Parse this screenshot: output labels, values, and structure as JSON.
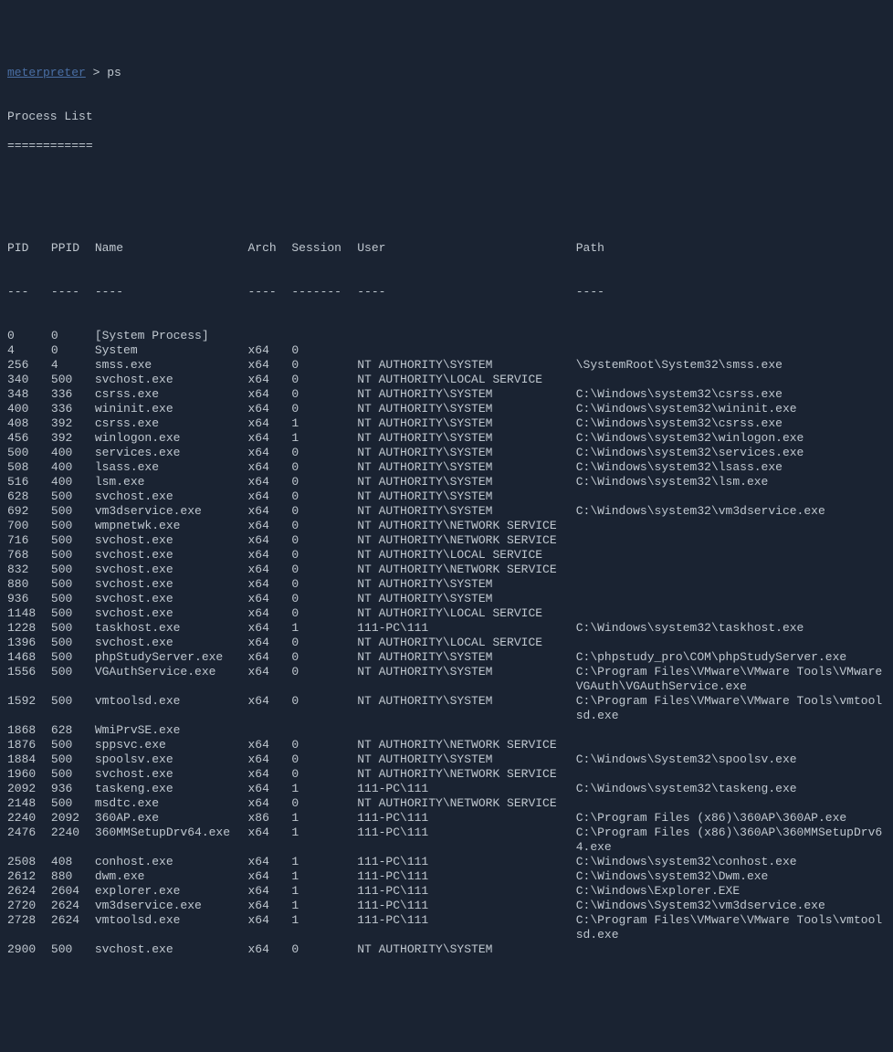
{
  "prompt": {
    "label": "meterpreter",
    "separator": " > ",
    "command": "ps"
  },
  "title": "Process List",
  "title_underline": "============",
  "headers": {
    "pid": "PID",
    "ppid": "PPID",
    "name": "Name",
    "arch": "Arch",
    "session": "Session",
    "user": "User",
    "path": "Path"
  },
  "header_underlines": {
    "pid": "---",
    "ppid": "----",
    "name": "----",
    "arch": "----",
    "session": "-------",
    "user": "----",
    "path": "----"
  },
  "processes": [
    {
      "pid": "0",
      "ppid": "0",
      "name": "[System Process]",
      "arch": "",
      "session": "",
      "user": "",
      "path": ""
    },
    {
      "pid": "4",
      "ppid": "0",
      "name": "System",
      "arch": "x64",
      "session": "0",
      "user": "",
      "path": ""
    },
    {
      "pid": "256",
      "ppid": "4",
      "name": "smss.exe",
      "arch": "x64",
      "session": "0",
      "user": "NT AUTHORITY\\SYSTEM",
      "path": "\\SystemRoot\\System32\\smss.exe"
    },
    {
      "pid": "340",
      "ppid": "500",
      "name": "svchost.exe",
      "arch": "x64",
      "session": "0",
      "user": "NT AUTHORITY\\LOCAL SERVICE",
      "path": ""
    },
    {
      "pid": "348",
      "ppid": "336",
      "name": "csrss.exe",
      "arch": "x64",
      "session": "0",
      "user": "NT AUTHORITY\\SYSTEM",
      "path": "C:\\Windows\\system32\\csrss.exe"
    },
    {
      "pid": "400",
      "ppid": "336",
      "name": "wininit.exe",
      "arch": "x64",
      "session": "0",
      "user": "NT AUTHORITY\\SYSTEM",
      "path": "C:\\Windows\\system32\\wininit.exe"
    },
    {
      "pid": "408",
      "ppid": "392",
      "name": "csrss.exe",
      "arch": "x64",
      "session": "1",
      "user": "NT AUTHORITY\\SYSTEM",
      "path": "C:\\Windows\\system32\\csrss.exe"
    },
    {
      "pid": "456",
      "ppid": "392",
      "name": "winlogon.exe",
      "arch": "x64",
      "session": "1",
      "user": "NT AUTHORITY\\SYSTEM",
      "path": "C:\\Windows\\system32\\winlogon.exe"
    },
    {
      "pid": "500",
      "ppid": "400",
      "name": "services.exe",
      "arch": "x64",
      "session": "0",
      "user": "NT AUTHORITY\\SYSTEM",
      "path": "C:\\Windows\\system32\\services.exe"
    },
    {
      "pid": "508",
      "ppid": "400",
      "name": "lsass.exe",
      "arch": "x64",
      "session": "0",
      "user": "NT AUTHORITY\\SYSTEM",
      "path": "C:\\Windows\\system32\\lsass.exe"
    },
    {
      "pid": "516",
      "ppid": "400",
      "name": "lsm.exe",
      "arch": "x64",
      "session": "0",
      "user": "NT AUTHORITY\\SYSTEM",
      "path": "C:\\Windows\\system32\\lsm.exe"
    },
    {
      "pid": "628",
      "ppid": "500",
      "name": "svchost.exe",
      "arch": "x64",
      "session": "0",
      "user": "NT AUTHORITY\\SYSTEM",
      "path": ""
    },
    {
      "pid": "692",
      "ppid": "500",
      "name": "vm3dservice.exe",
      "arch": "x64",
      "session": "0",
      "user": "NT AUTHORITY\\SYSTEM",
      "path": "C:\\Windows\\system32\\vm3dservice.exe"
    },
    {
      "pid": "700",
      "ppid": "500",
      "name": "wmpnetwk.exe",
      "arch": "x64",
      "session": "0",
      "user": "NT AUTHORITY\\NETWORK SERVICE",
      "path": ""
    },
    {
      "pid": "716",
      "ppid": "500",
      "name": "svchost.exe",
      "arch": "x64",
      "session": "0",
      "user": "NT AUTHORITY\\NETWORK SERVICE",
      "path": ""
    },
    {
      "pid": "768",
      "ppid": "500",
      "name": "svchost.exe",
      "arch": "x64",
      "session": "0",
      "user": "NT AUTHORITY\\LOCAL SERVICE",
      "path": ""
    },
    {
      "pid": "832",
      "ppid": "500",
      "name": "svchost.exe",
      "arch": "x64",
      "session": "0",
      "user": "NT AUTHORITY\\NETWORK SERVICE",
      "path": ""
    },
    {
      "pid": "880",
      "ppid": "500",
      "name": "svchost.exe",
      "arch": "x64",
      "session": "0",
      "user": "NT AUTHORITY\\SYSTEM",
      "path": ""
    },
    {
      "pid": "936",
      "ppid": "500",
      "name": "svchost.exe",
      "arch": "x64",
      "session": "0",
      "user": "NT AUTHORITY\\SYSTEM",
      "path": ""
    },
    {
      "pid": "1148",
      "ppid": "500",
      "name": "svchost.exe",
      "arch": "x64",
      "session": "0",
      "user": "NT AUTHORITY\\LOCAL SERVICE",
      "path": ""
    },
    {
      "pid": "1228",
      "ppid": "500",
      "name": "taskhost.exe",
      "arch": "x64",
      "session": "1",
      "user": "111-PC\\111",
      "path": "C:\\Windows\\system32\\taskhost.exe"
    },
    {
      "pid": "1396",
      "ppid": "500",
      "name": "svchost.exe",
      "arch": "x64",
      "session": "0",
      "user": "NT AUTHORITY\\LOCAL SERVICE",
      "path": ""
    },
    {
      "pid": "1468",
      "ppid": "500",
      "name": "phpStudyServer.exe",
      "arch": "x64",
      "session": "0",
      "user": "NT AUTHORITY\\SYSTEM",
      "path": "C:\\phpstudy_pro\\COM\\phpStudyServer.exe"
    },
    {
      "pid": "1556",
      "ppid": "500",
      "name": "VGAuthService.exe",
      "arch": "x64",
      "session": "0",
      "user": "NT AUTHORITY\\SYSTEM",
      "path": "C:\\Program Files\\VMware\\VMware Tools\\VMware VGAuth\\VGAuthService.exe"
    },
    {
      "pid": "1592",
      "ppid": "500",
      "name": "vmtoolsd.exe",
      "arch": "x64",
      "session": "0",
      "user": "NT AUTHORITY\\SYSTEM",
      "path": "C:\\Program Files\\VMware\\VMware Tools\\vmtoolsd.exe"
    },
    {
      "pid": "1868",
      "ppid": "628",
      "name": "WmiPrvSE.exe",
      "arch": "",
      "session": "",
      "user": "",
      "path": ""
    },
    {
      "pid": "1876",
      "ppid": "500",
      "name": "sppsvc.exe",
      "arch": "x64",
      "session": "0",
      "user": "NT AUTHORITY\\NETWORK SERVICE",
      "path": ""
    },
    {
      "pid": "1884",
      "ppid": "500",
      "name": "spoolsv.exe",
      "arch": "x64",
      "session": "0",
      "user": "NT AUTHORITY\\SYSTEM",
      "path": "C:\\Windows\\System32\\spoolsv.exe"
    },
    {
      "pid": "1960",
      "ppid": "500",
      "name": "svchost.exe",
      "arch": "x64",
      "session": "0",
      "user": "NT AUTHORITY\\NETWORK SERVICE",
      "path": ""
    },
    {
      "pid": "2092",
      "ppid": "936",
      "name": "taskeng.exe",
      "arch": "x64",
      "session": "1",
      "user": "111-PC\\111",
      "path": "C:\\Windows\\system32\\taskeng.exe"
    },
    {
      "pid": "2148",
      "ppid": "500",
      "name": "msdtc.exe",
      "arch": "x64",
      "session": "0",
      "user": "NT AUTHORITY\\NETWORK SERVICE",
      "path": ""
    },
    {
      "pid": "2240",
      "ppid": "2092",
      "name": "360AP.exe",
      "arch": "x86",
      "session": "1",
      "user": "111-PC\\111",
      "path": "C:\\Program Files (x86)\\360AP\\360AP.exe"
    },
    {
      "pid": "2476",
      "ppid": "2240",
      "name": "360MMSetupDrv64.exe",
      "arch": "x64",
      "session": "1",
      "user": "111-PC\\111",
      "path": "C:\\Program Files (x86)\\360AP\\360MMSetupDrv64.exe"
    },
    {
      "pid": "2508",
      "ppid": "408",
      "name": "conhost.exe",
      "arch": "x64",
      "session": "1",
      "user": "111-PC\\111",
      "path": "C:\\Windows\\system32\\conhost.exe"
    },
    {
      "pid": "2612",
      "ppid": "880",
      "name": "dwm.exe",
      "arch": "x64",
      "session": "1",
      "user": "111-PC\\111",
      "path": "C:\\Windows\\system32\\Dwm.exe"
    },
    {
      "pid": "2624",
      "ppid": "2604",
      "name": "explorer.exe",
      "arch": "x64",
      "session": "1",
      "user": "111-PC\\111",
      "path": "C:\\Windows\\Explorer.EXE"
    },
    {
      "pid": "2720",
      "ppid": "2624",
      "name": "vm3dservice.exe",
      "arch": "x64",
      "session": "1",
      "user": "111-PC\\111",
      "path": "C:\\Windows\\System32\\vm3dservice.exe"
    },
    {
      "pid": "2728",
      "ppid": "2624",
      "name": "vmtoolsd.exe",
      "arch": "x64",
      "session": "1",
      "user": "111-PC\\111",
      "path": "C:\\Program Files\\VMware\\VMware Tools\\vmtoolsd.exe"
    },
    {
      "pid": "2900",
      "ppid": "500",
      "name": "svchost.exe",
      "arch": "x64",
      "session": "0",
      "user": "NT AUTHORITY\\SYSTEM",
      "path": ""
    }
  ]
}
